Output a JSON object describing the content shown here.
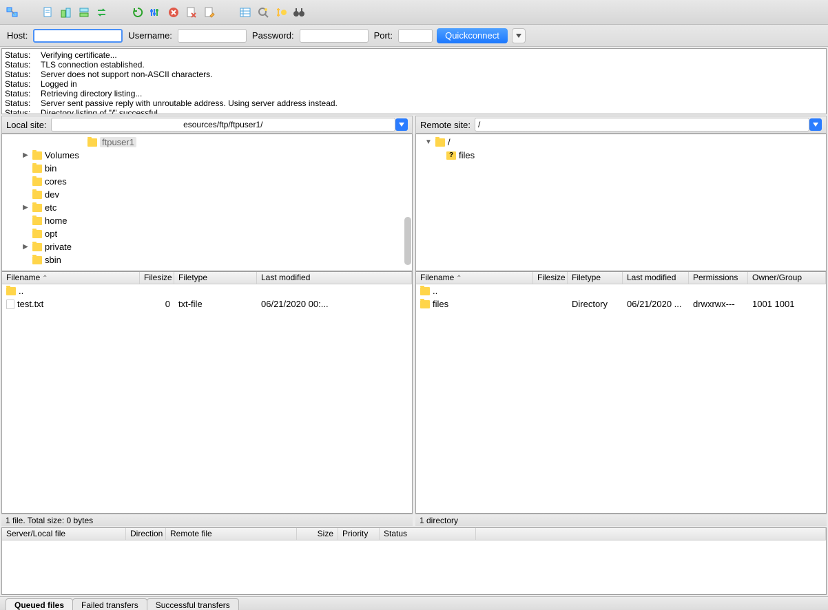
{
  "toolbar_icons": [
    "site-manager",
    "divider",
    "doc",
    "split-v",
    "split-h",
    "swap",
    "divider",
    "refresh",
    "filter",
    "cancel",
    "file-x",
    "file-edit",
    "divider",
    "list",
    "search",
    "sync",
    "binoculars"
  ],
  "conn": {
    "host_label": "Host:",
    "user_label": "Username:",
    "pass_label": "Password:",
    "port_label": "Port:",
    "quickconnect": "Quickconnect"
  },
  "log": [
    {
      "pfx": "Status:",
      "msg": "Verifying certificate..."
    },
    {
      "pfx": "Status:",
      "msg": "TLS connection established."
    },
    {
      "pfx": "Status:",
      "msg": "Server does not support non-ASCII characters."
    },
    {
      "pfx": "Status:",
      "msg": "Logged in"
    },
    {
      "pfx": "Status:",
      "msg": "Retrieving directory listing..."
    },
    {
      "pfx": "Status:",
      "msg": "Server sent passive reply with unroutable address. Using server address instead."
    },
    {
      "pfx": "Status:",
      "msg": "Directory listing of \"/\" successful"
    }
  ],
  "local": {
    "label": "Local site:",
    "path_display": "esources/ftp/ftpuser1/",
    "tree": [
      {
        "indent": 6,
        "caret": "",
        "name": "ftpuser1",
        "selected": true
      },
      {
        "indent": 1,
        "caret": "▶",
        "name": "Volumes"
      },
      {
        "indent": 1,
        "caret": "",
        "name": "bin"
      },
      {
        "indent": 1,
        "caret": "",
        "name": "cores"
      },
      {
        "indent": 1,
        "caret": "",
        "name": "dev"
      },
      {
        "indent": 1,
        "caret": "▶",
        "name": "etc"
      },
      {
        "indent": 1,
        "caret": "",
        "name": "home"
      },
      {
        "indent": 1,
        "caret": "",
        "name": "opt"
      },
      {
        "indent": 1,
        "caret": "▶",
        "name": "private"
      },
      {
        "indent": 1,
        "caret": "",
        "name": "sbin"
      }
    ],
    "cols": {
      "name": "Filename",
      "size": "Filesize",
      "type": "Filetype",
      "mod": "Last modified"
    },
    "rows": [
      {
        "icon": "folder",
        "name": "..",
        "size": "",
        "type": "",
        "mod": ""
      },
      {
        "icon": "file",
        "name": "test.txt",
        "size": "0",
        "type": "txt-file",
        "mod": "06/21/2020 00:..."
      }
    ],
    "status": "1 file. Total size: 0 bytes"
  },
  "remote": {
    "label": "Remote site:",
    "path_display": "/",
    "tree": [
      {
        "indent": 0,
        "caret": "▼",
        "name": "/",
        "icon": "folder"
      },
      {
        "indent": 1,
        "caret": "",
        "name": "files",
        "icon": "folderq"
      }
    ],
    "cols": {
      "name": "Filename",
      "size": "Filesize",
      "type": "Filetype",
      "mod": "Last modified",
      "perm": "Permissions",
      "owner": "Owner/Group"
    },
    "rows": [
      {
        "icon": "folder",
        "name": "..",
        "size": "",
        "type": "",
        "mod": "",
        "perm": "",
        "owner": ""
      },
      {
        "icon": "folder",
        "name": "files",
        "size": "",
        "type": "Directory",
        "mod": "06/21/2020 ...",
        "perm": "drwxrwx---",
        "owner": "1001 1001"
      }
    ],
    "status": "1 directory"
  },
  "queue_cols": {
    "server": "Server/Local file",
    "dir": "Direction",
    "remote": "Remote file",
    "size": "Size",
    "pri": "Priority",
    "status": "Status"
  },
  "tabs": {
    "queued": "Queued files",
    "failed": "Failed transfers",
    "success": "Successful transfers"
  }
}
